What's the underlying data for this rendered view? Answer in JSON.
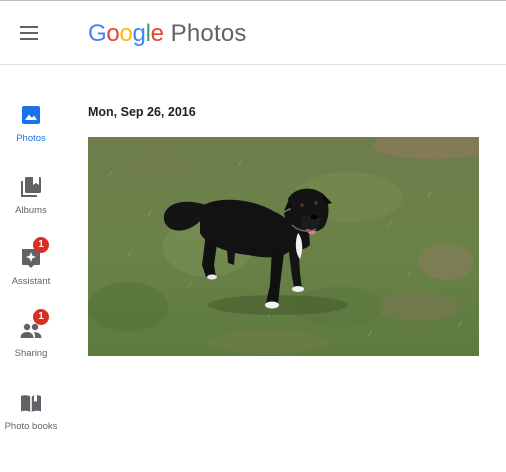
{
  "header": {
    "logo_letters": [
      {
        "char": "G",
        "color": "#4285F4"
      },
      {
        "char": "o",
        "color": "#EA4335"
      },
      {
        "char": "o",
        "color": "#FBBC05"
      },
      {
        "char": "g",
        "color": "#4285F4"
      },
      {
        "char": "l",
        "color": "#34A853"
      },
      {
        "char": "e",
        "color": "#EA4335"
      }
    ],
    "product": "Photos",
    "menu_icon": "hamburger-menu-icon"
  },
  "sidebar": {
    "items": [
      {
        "label": "Photos",
        "icon": "photo-icon",
        "active": true,
        "badge": null
      },
      {
        "label": "Albums",
        "icon": "album-icon",
        "active": false,
        "badge": null
      },
      {
        "label": "Assistant",
        "icon": "assistant-icon",
        "active": false,
        "badge": "1"
      },
      {
        "label": "Sharing",
        "icon": "people-icon",
        "active": false,
        "badge": "1"
      },
      {
        "label": "Photo books",
        "icon": "book-icon",
        "active": false,
        "badge": null
      }
    ]
  },
  "main": {
    "date_heading": "Mon, Sep 26, 2016",
    "photos": [
      {
        "subject": "black-and-white-dog-on-grass"
      }
    ]
  },
  "colors": {
    "accent": "#1a73e8",
    "badge": "#d93025",
    "icon_grey": "#5f6368"
  }
}
